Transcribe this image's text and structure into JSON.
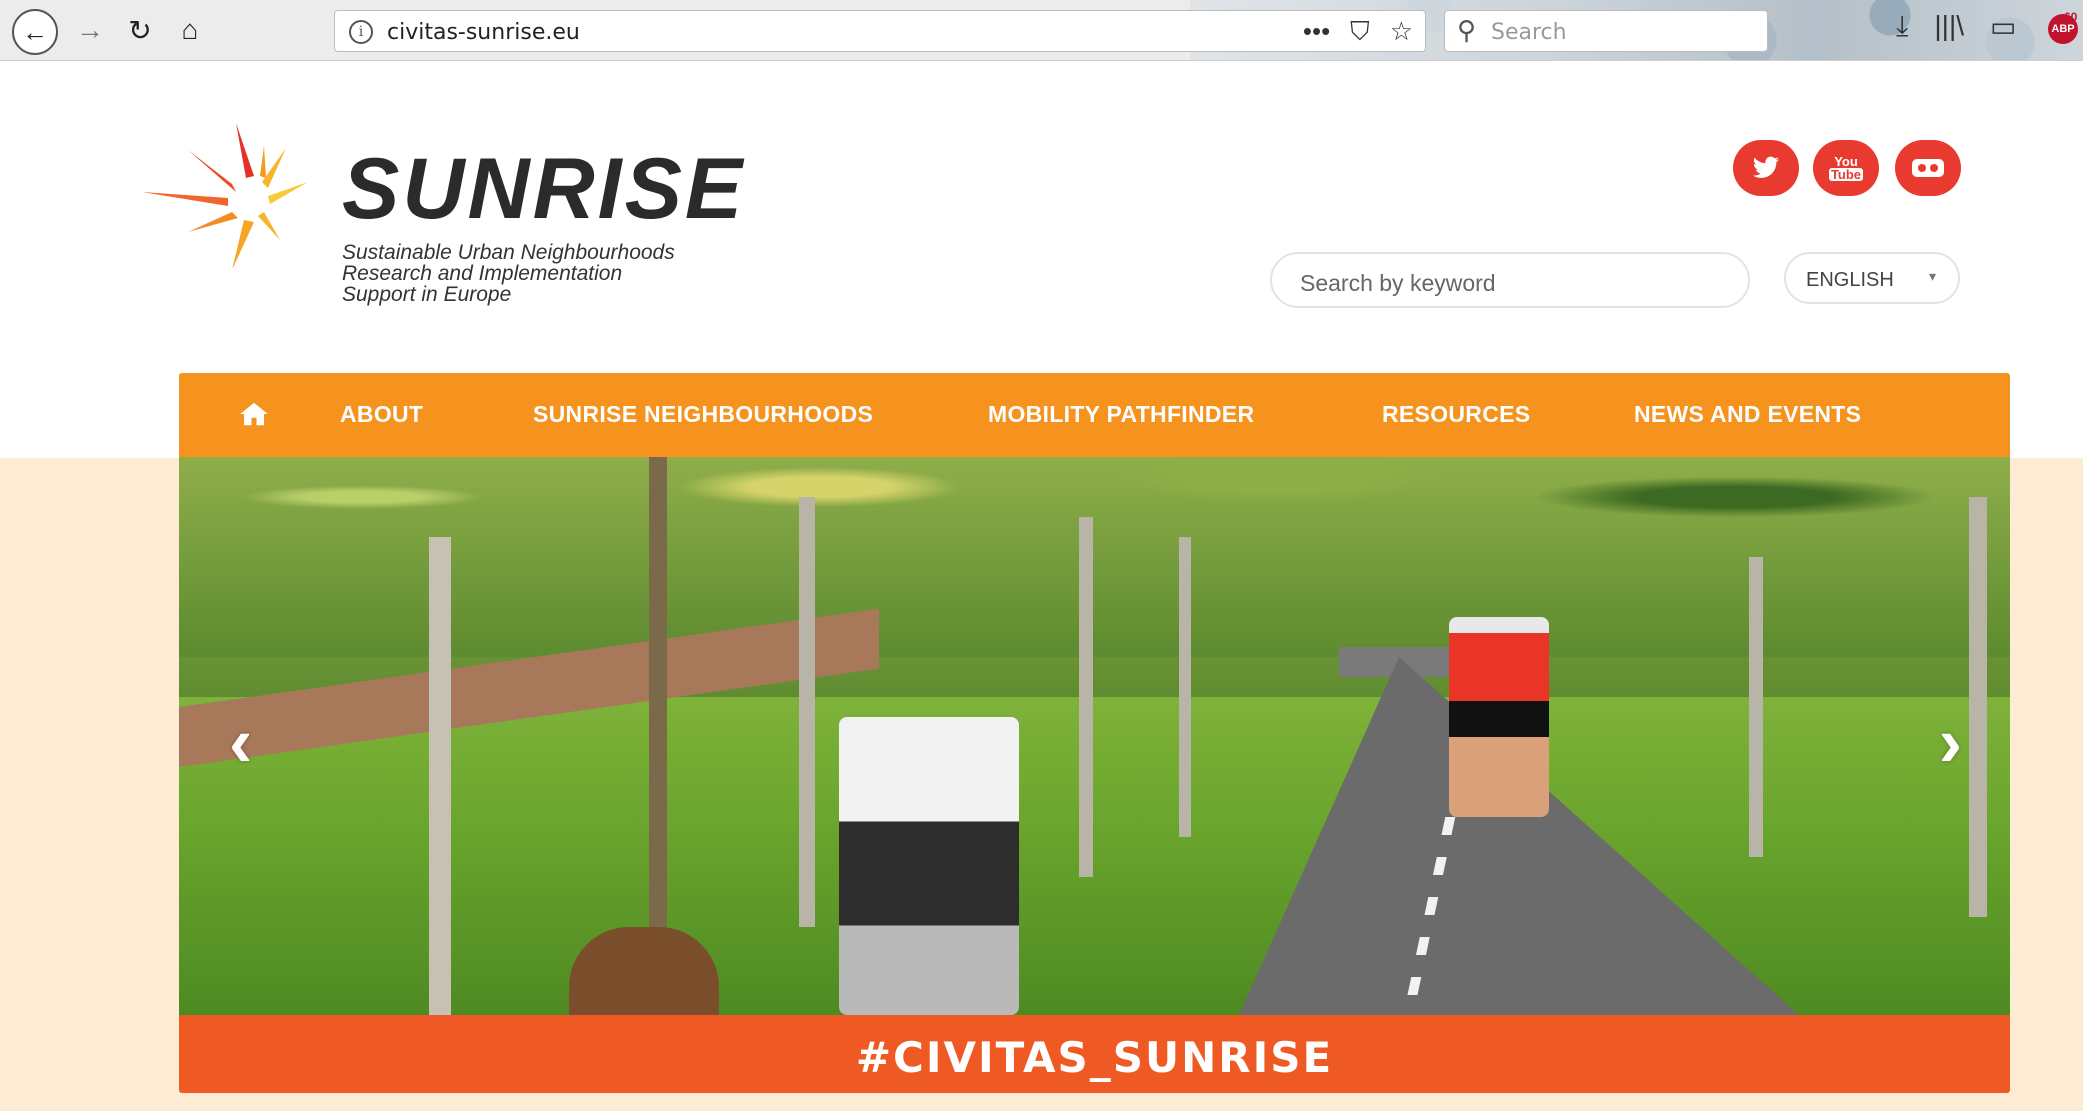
{
  "browser": {
    "back_icon": "←",
    "forward_icon": "→",
    "reload_icon": "↻",
    "home_icon": "⌂",
    "info_icon": "i",
    "url": "civitas-sunrise.eu",
    "page_actions": [
      "•••",
      "⛉",
      "☆"
    ],
    "search_icon": "⚲",
    "search_placeholder": "Search",
    "toolbar_icons": [
      "⤓",
      "|||\\",
      "▭"
    ],
    "adblock_label": "ABP",
    "adblock_count": "60"
  },
  "site": {
    "logo": {
      "title": "SUNRISE",
      "subtitle_lines": [
        "Sustainable Urban Neighbourhoods",
        "Research and Implementation",
        "Support in Europe"
      ]
    },
    "social": {
      "twitter_glyph": "🐦",
      "youtube_top": "You",
      "youtube_bottom": "Tube"
    },
    "search_placeholder": "Search by keyword",
    "language": {
      "label": "ENGLISH",
      "caret": "▾"
    },
    "nav": {
      "items": [
        "ABOUT",
        "SUNRISE NEIGHBOURHOODS",
        "MOBILITY PATHFINDER",
        "RESOURCES",
        "NEWS AND EVENTS"
      ]
    },
    "slider": {
      "prev": "‹",
      "next": "›",
      "hashtag": "#CIVITAS_SUNRISE"
    }
  },
  "colors": {
    "nav_orange": "#f6921e",
    "hashtag_orange": "#ef5a24",
    "social_red": "#e83a2e",
    "peach_bg": "#fdebd3"
  }
}
